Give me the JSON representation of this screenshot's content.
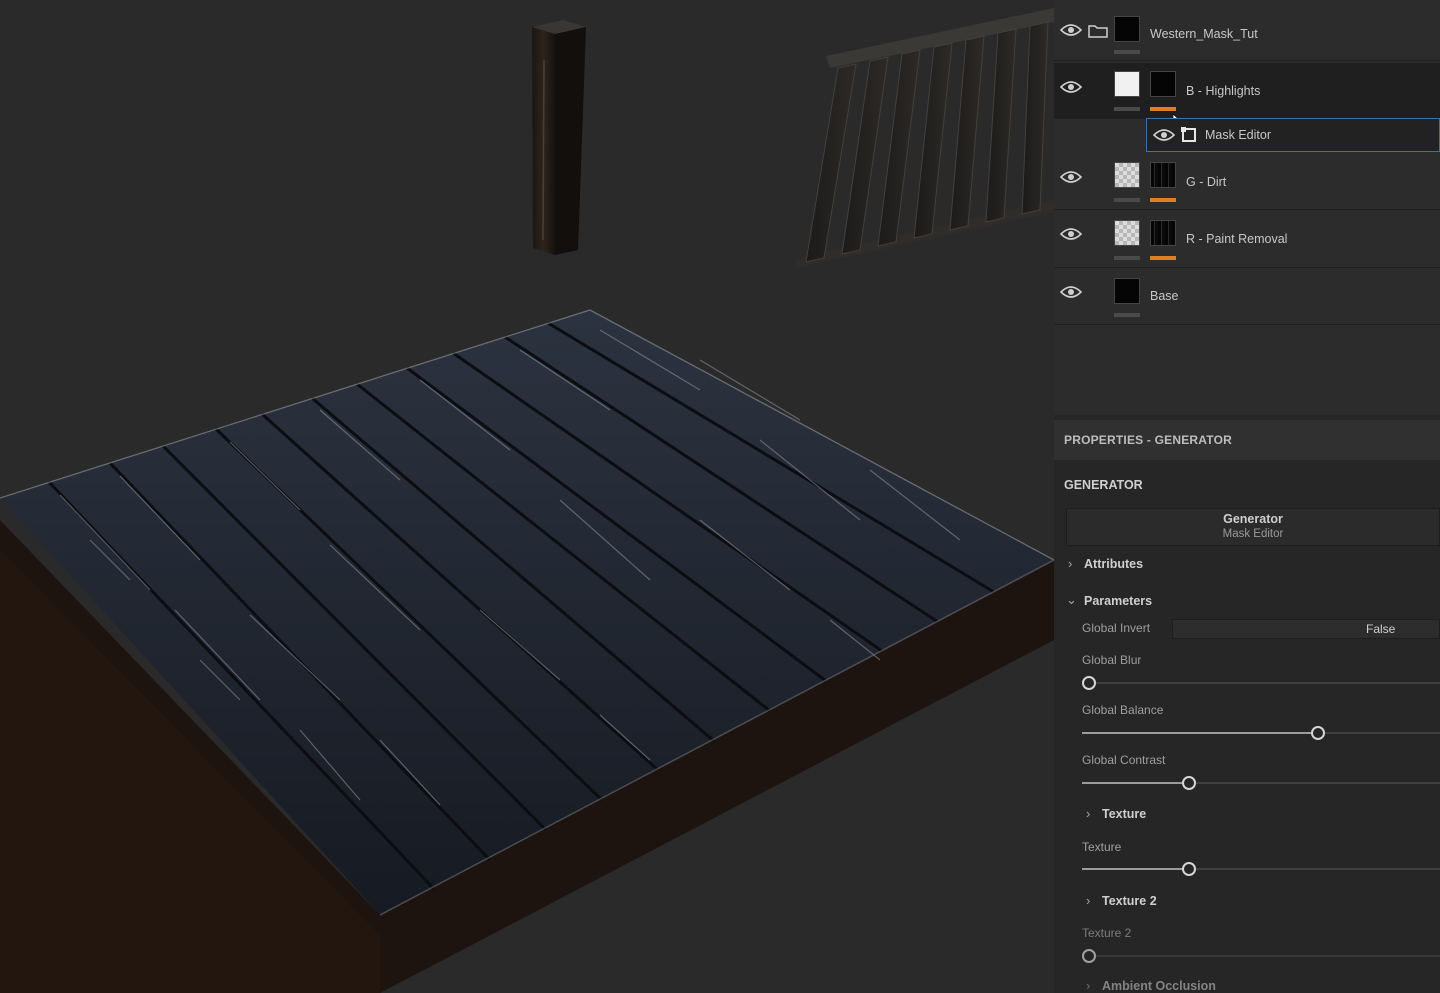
{
  "layers": [
    {
      "name": "Western_Mask_Tut",
      "type": "folder",
      "visible": true
    },
    {
      "name": "B - Highlights",
      "type": "fill",
      "visible": true,
      "selected": true
    },
    {
      "name": "Mask Editor",
      "type": "generator",
      "visible": true
    },
    {
      "name": "G - Dirt",
      "type": "fill",
      "visible": true
    },
    {
      "name": "R - Paint Removal",
      "type": "fill",
      "visible": true
    },
    {
      "name": "Base",
      "type": "fill",
      "visible": true
    }
  ],
  "properties": {
    "header": "PROPERTIES - GENERATOR",
    "section": "GENERATOR",
    "generator_title": "Generator",
    "generator_subtitle": "Mask Editor",
    "attributes_label": "Attributes",
    "parameters_label": "Parameters",
    "global_invert": {
      "label": "Global Invert",
      "value": "False"
    },
    "sliders": [
      {
        "label": "Global Blur",
        "value": 0.0
      },
      {
        "label": "Global Balance",
        "value": 0.66
      },
      {
        "label": "Global Contrast",
        "value": 0.3
      }
    ],
    "texture_section": "Texture",
    "texture_slider": {
      "label": "Texture",
      "value": 0.3
    },
    "texture2_section": "Texture 2",
    "texture2_slider": {
      "label": "Texture 2",
      "value": 0.0
    },
    "ambient_occlusion_section": "Ambient Occlusion"
  },
  "colors": {
    "accent_orange": "#e07f20",
    "panel_bg": "#262626",
    "viewport_bg": "#2a2a2a"
  }
}
